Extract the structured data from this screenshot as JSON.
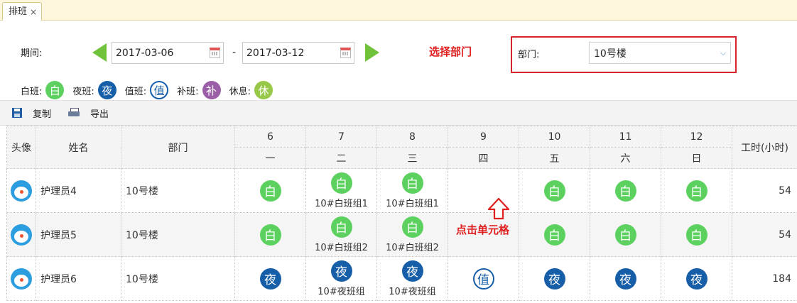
{
  "tabbar": {
    "tab_label": "排班",
    "close_glyph": "×"
  },
  "period": {
    "label": "期间:",
    "start_date": "2017-03-06",
    "separator": "-",
    "end_date": "2017-03-12"
  },
  "annotations": {
    "select_department": "选择部门",
    "click_cell": "点击单元格"
  },
  "department": {
    "label": "部门:",
    "selected": "10号楼"
  },
  "legend": [
    {
      "label": "白班:",
      "glyph": "白",
      "kind": "bai"
    },
    {
      "label": "夜班:",
      "glyph": "夜",
      "kind": "ye"
    },
    {
      "label": "值班:",
      "glyph": "值",
      "kind": "zhi"
    },
    {
      "label": "补班:",
      "glyph": "补",
      "kind": "bu"
    },
    {
      "label": "休息:",
      "glyph": "休",
      "kind": "xiu"
    }
  ],
  "toolbar": {
    "copy_label": "复制",
    "export_label": "导出"
  },
  "table": {
    "headers": {
      "avatar": "头像",
      "name": "姓名",
      "department": "部门",
      "hours": "工时(小时)"
    },
    "days": [
      {
        "date": "6",
        "weekday": "一"
      },
      {
        "date": "7",
        "weekday": "二"
      },
      {
        "date": "8",
        "weekday": "三"
      },
      {
        "date": "9",
        "weekday": "四"
      },
      {
        "date": "10",
        "weekday": "五"
      },
      {
        "date": "11",
        "weekday": "六"
      },
      {
        "date": "12",
        "weekday": "日"
      }
    ],
    "rows": [
      {
        "name": "护理员4",
        "department": "10号楼",
        "hours": "54",
        "cells": [
          {
            "shift": "白",
            "kind": "bai",
            "group": ""
          },
          {
            "shift": "白",
            "kind": "bai",
            "group": "10#白班组1"
          },
          {
            "shift": "白",
            "kind": "bai",
            "group": "10#白班组1"
          },
          {
            "shift": "",
            "kind": "",
            "group": ""
          },
          {
            "shift": "白",
            "kind": "bai",
            "group": ""
          },
          {
            "shift": "白",
            "kind": "bai",
            "group": ""
          },
          {
            "shift": "白",
            "kind": "bai",
            "group": ""
          }
        ]
      },
      {
        "name": "护理员5",
        "department": "10号楼",
        "hours": "54",
        "cells": [
          {
            "shift": "白",
            "kind": "bai",
            "group": ""
          },
          {
            "shift": "白",
            "kind": "bai",
            "group": "10#白班组2"
          },
          {
            "shift": "白",
            "kind": "bai",
            "group": "10#白班组2"
          },
          {
            "shift": "",
            "kind": "",
            "group": ""
          },
          {
            "shift": "白",
            "kind": "bai",
            "group": ""
          },
          {
            "shift": "白",
            "kind": "bai",
            "group": ""
          },
          {
            "shift": "白",
            "kind": "bai",
            "group": ""
          }
        ]
      },
      {
        "name": "护理员6",
        "department": "10号楼",
        "hours": "184",
        "cells": [
          {
            "shift": "夜",
            "kind": "ye",
            "group": ""
          },
          {
            "shift": "夜",
            "kind": "ye",
            "group": "10#夜班组"
          },
          {
            "shift": "夜",
            "kind": "ye",
            "group": "10#夜班组"
          },
          {
            "shift": "值",
            "kind": "zhi",
            "group": ""
          },
          {
            "shift": "夜",
            "kind": "ye",
            "group": ""
          },
          {
            "shift": "夜",
            "kind": "ye",
            "group": ""
          },
          {
            "shift": "夜",
            "kind": "ye",
            "group": ""
          }
        ]
      }
    ]
  }
}
